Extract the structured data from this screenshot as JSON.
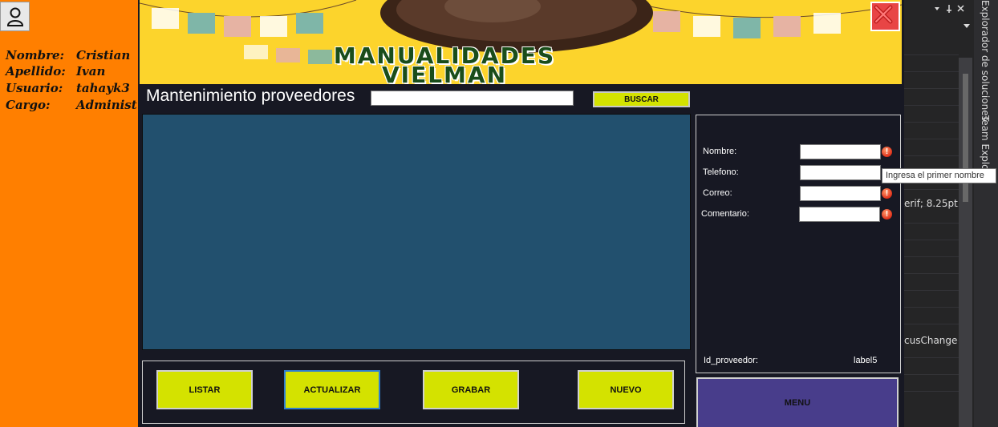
{
  "user_panel": {
    "rows": [
      {
        "key": "Nombre:",
        "value": "Cristian"
      },
      {
        "key": "Apellido:",
        "value": "Ivan"
      },
      {
        "key": "Usuario:",
        "value": "tahayk3"
      },
      {
        "key": "Cargo:",
        "value": "Administ"
      }
    ]
  },
  "banner": {
    "line1": "MANUALIDADES",
    "line2": "VIELMAN"
  },
  "header": {
    "title": "Mantenimiento proveedores",
    "search_value": "",
    "search_button": "BUSCAR"
  },
  "form": {
    "fields": [
      {
        "label": "Nombre:",
        "value": ""
      },
      {
        "label": "Telefono:",
        "value": ""
      },
      {
        "label": "Correo:",
        "value": ""
      },
      {
        "label": "Comentario:",
        "value": ""
      }
    ],
    "error_glyph": "!",
    "id_label": "Id_proveedor:",
    "id_value": "label5",
    "tooltip": "Ingresa el primer nombre"
  },
  "actions": {
    "listar": "LISTAR",
    "actualizar": "ACTUALIZAR",
    "grabar": "GRABAR",
    "nuevo": "NUEVO",
    "menu": "MENU"
  },
  "ide": {
    "texts": [
      "erif; 8.25pt",
      "cusChange"
    ],
    "side_tabs": [
      "Explorador de soluciones",
      "Team Explor"
    ]
  },
  "colors": {
    "user_panel": "#ff7f00",
    "app_bg": "#171823",
    "banner_bg": "#fcd42c",
    "button_accent": "#d4e200",
    "grid_bg": "#22506e",
    "menu_button": "#483d8b",
    "close_button": "#e84545"
  }
}
